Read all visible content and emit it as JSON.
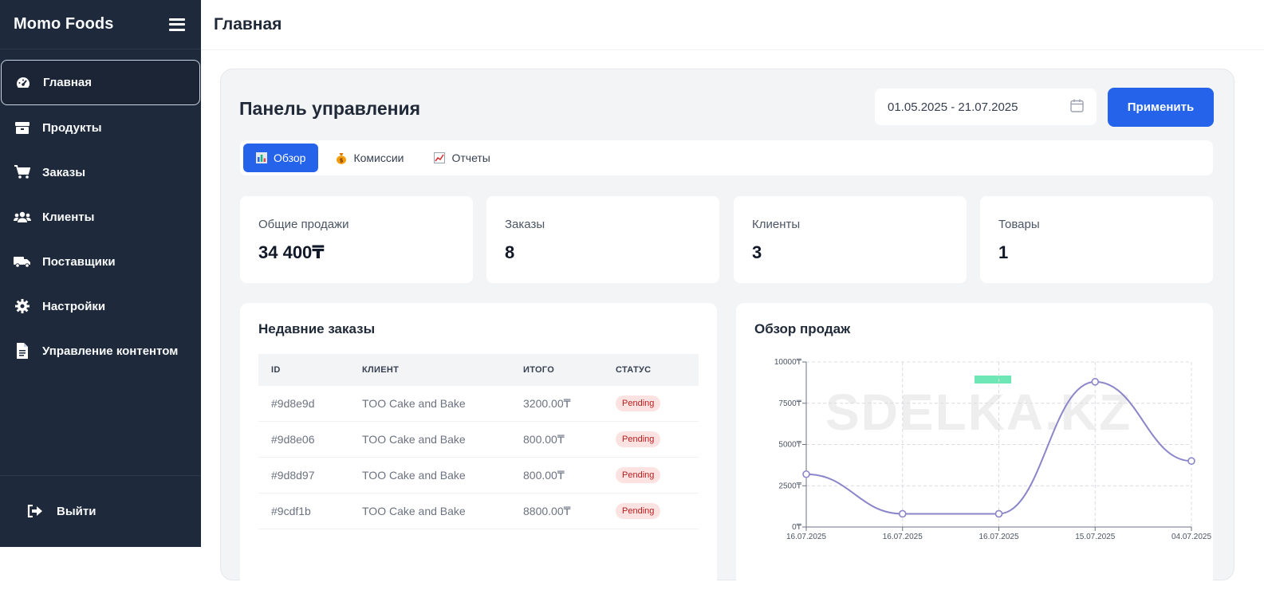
{
  "sidebar": {
    "brand": "Momo Foods",
    "items": [
      {
        "label": "Главная",
        "icon": "dashboard-icon",
        "active": true
      },
      {
        "label": "Продукты",
        "icon": "box-icon"
      },
      {
        "label": "Заказы",
        "icon": "cart-icon"
      },
      {
        "label": "Клиенты",
        "icon": "users-icon"
      },
      {
        "label": "Поставщики",
        "icon": "truck-icon"
      },
      {
        "label": "Настройки",
        "icon": "gear-icon"
      },
      {
        "label": "Управление контентом",
        "icon": "document-icon"
      }
    ],
    "logout_label": "Выйти"
  },
  "header": {
    "title": "Главная"
  },
  "panel": {
    "title": "Панель управления",
    "date_range": "01.05.2025 - 21.07.2025",
    "apply_label": "Применить",
    "tabs": [
      {
        "label": "Обзор",
        "icon": "bar-chart-icon",
        "active": true
      },
      {
        "label": "Комиссии",
        "icon": "money-bag-icon"
      },
      {
        "label": "Отчеты",
        "icon": "line-chart-icon"
      }
    ]
  },
  "stats": [
    {
      "label": "Общие продажи",
      "value": "34 400₸"
    },
    {
      "label": "Заказы",
      "value": "8"
    },
    {
      "label": "Клиенты",
      "value": "3"
    },
    {
      "label": "Товары",
      "value": "1"
    }
  ],
  "recent_orders": {
    "title": "Недавние заказы",
    "columns": [
      "ID",
      "КЛИЕНТ",
      "ИТОГО",
      "СТАТУС"
    ],
    "rows": [
      {
        "id": "#9d8e9d",
        "client": "TOO Cake and Bake",
        "total": "3200.00₸",
        "status": "Pending"
      },
      {
        "id": "#9d8e06",
        "client": "TOO Cake and Bake",
        "total": "800.00₸",
        "status": "Pending"
      },
      {
        "id": "#9d8d97",
        "client": "TOO Cake and Bake",
        "total": "800.00₸",
        "status": "Pending"
      },
      {
        "id": "#9cdf1b",
        "client": "TOO Cake and Bake",
        "total": "8800.00₸",
        "status": "Pending"
      }
    ]
  },
  "sales_overview": {
    "title": "Обзор продаж",
    "watermark": "SDELKA.KZ",
    "line_color": "#8b85c9",
    "legend_color": "#6ee7b7"
  },
  "chart_data": {
    "type": "line",
    "x": [
      "16.07.2025",
      "16.07.2025",
      "16.07.2025",
      "15.07.2025",
      "04.07.2025"
    ],
    "series": [
      {
        "values": [
          3200,
          800,
          800,
          8800,
          4000
        ]
      }
    ],
    "yticks": [
      "0₸",
      "2500₸",
      "5000₸",
      "7500₸",
      "10000₸"
    ],
    "ylim": [
      0,
      10000
    ],
    "grid": true,
    "curve": "smooth"
  }
}
